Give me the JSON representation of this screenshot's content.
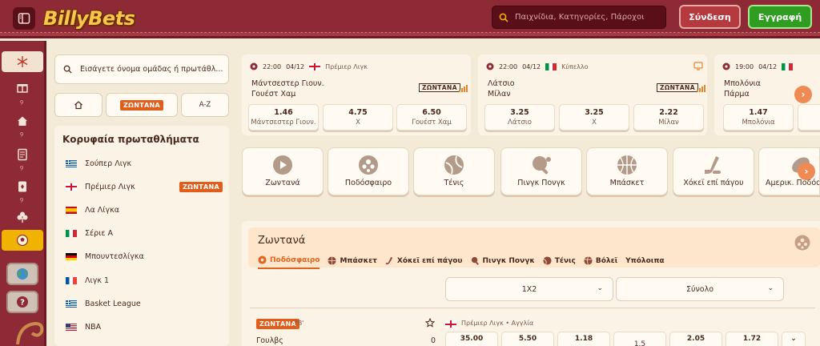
{
  "header": {
    "logo_text": "BillyBets",
    "search_placeholder": "Παιχνίδια, Κατηγορίες, Πάροχοι",
    "login_label": "Σύνδεση",
    "register_label": "Εγγραφή",
    "colors": {
      "header": "#8e2a36",
      "login": "#b53a40",
      "register": "#2f9d1f",
      "accent": "#e0651f"
    }
  },
  "rail": {
    "icons": [
      "snowflake-icon",
      "gift-icon",
      "home-icon",
      "coupon-icon",
      "card-icon",
      "clover-icon",
      "ball-icon",
      "globe-icon",
      "help-icon"
    ]
  },
  "left": {
    "search_placeholder": "Εισάγετε όνομα ομάδας ή πρωτάθλ...",
    "filter_live": "ΖΩΝΤΑΝΑ",
    "filter_az": "A-Z",
    "leagues_title": "Κορυφαία πρωταθλήματα",
    "leagues": [
      {
        "name": "Σούπερ Λιγκ",
        "flag": "greece",
        "live": ""
      },
      {
        "name": "Πρέμιερ Λιγκ",
        "flag": "england",
        "live": "ΖΩΝΤΑΝΑ"
      },
      {
        "name": "Λα Λίγκα",
        "flag": "spain",
        "live": ""
      },
      {
        "name": "Σέριε A",
        "flag": "italy",
        "live": ""
      },
      {
        "name": "Μπουντεσλίγκα",
        "flag": "germany",
        "live": ""
      },
      {
        "name": "Λιγκ 1",
        "flag": "france",
        "live": ""
      },
      {
        "name": "Basket League",
        "flag": "greece",
        "live": ""
      },
      {
        "name": "NBA",
        "flag": "usa",
        "live": ""
      }
    ]
  },
  "matches": [
    {
      "time": "22:00",
      "date": "04/12",
      "league": "Πρέμιερ Λιγκ",
      "flag": "england",
      "home": "Μάντσεστερ Γιουν.",
      "away": "Γουέστ Χαμ",
      "live": "ΖΩΝΤΑΝΑ",
      "odds": [
        {
          "value": "1.46",
          "label": "Μάντσεστερ Γιουν."
        },
        {
          "value": "4.75",
          "label": "X"
        },
        {
          "value": "6.50",
          "label": "Γουέστ Χαμ"
        }
      ]
    },
    {
      "time": "22:00",
      "date": "04/12",
      "league": "Κύπελλο",
      "flag": "italy",
      "home": "Λάτσιο",
      "away": "Μίλαν",
      "live": "ΖΩΝΤΑΝΑ",
      "odds": [
        {
          "value": "3.25",
          "label": "Λάτσιο"
        },
        {
          "value": "3.25",
          "label": "X"
        },
        {
          "value": "2.22",
          "label": "Μίλαν"
        }
      ]
    },
    {
      "time": "19:00",
      "date": "04/12",
      "league": "",
      "flag": "italy",
      "home": "Μπολόνια",
      "away": "Πάρμα",
      "live": "",
      "odds": [
        {
          "value": "1.47",
          "label": "Μπολόνια"
        }
      ]
    }
  ],
  "sports": [
    {
      "label": "Ζωντανά",
      "icon": "play-icon"
    },
    {
      "label": "Ποδόσφαιρο",
      "icon": "football-icon"
    },
    {
      "label": "Τένις",
      "icon": "tennis-icon"
    },
    {
      "label": "Πινγκ Πονγκ",
      "icon": "pingpong-icon"
    },
    {
      "label": "Μπάσκετ",
      "icon": "basketball-icon"
    },
    {
      "label": "Χόκεϊ επί πάγου",
      "icon": "hockey-icon"
    },
    {
      "label": "Αμερικ. Ποδόσφ",
      "icon": "american-football-icon"
    }
  ],
  "live": {
    "title": "Ζωντανά",
    "tabs": [
      "Ποδόσφαιρο",
      "Μπάσκετ",
      "Χόκεϊ επί πάγου",
      "Πινγκ Πονγκ",
      "Τένις",
      "Βόλεϊ",
      "Υπόλοιπα"
    ],
    "market1": "1X2",
    "market2": "Σύνολο",
    "row": {
      "live": "ΖΩΝΤΑΝΑ",
      "minute": "78'",
      "league": "Πρέμιερ Λιγκ • Αγγλία",
      "team": "Γουλβς",
      "score": "0",
      "odds": [
        "35.00",
        "5.50",
        "1.18",
        "1.5",
        "2.05",
        "1.72"
      ]
    }
  }
}
